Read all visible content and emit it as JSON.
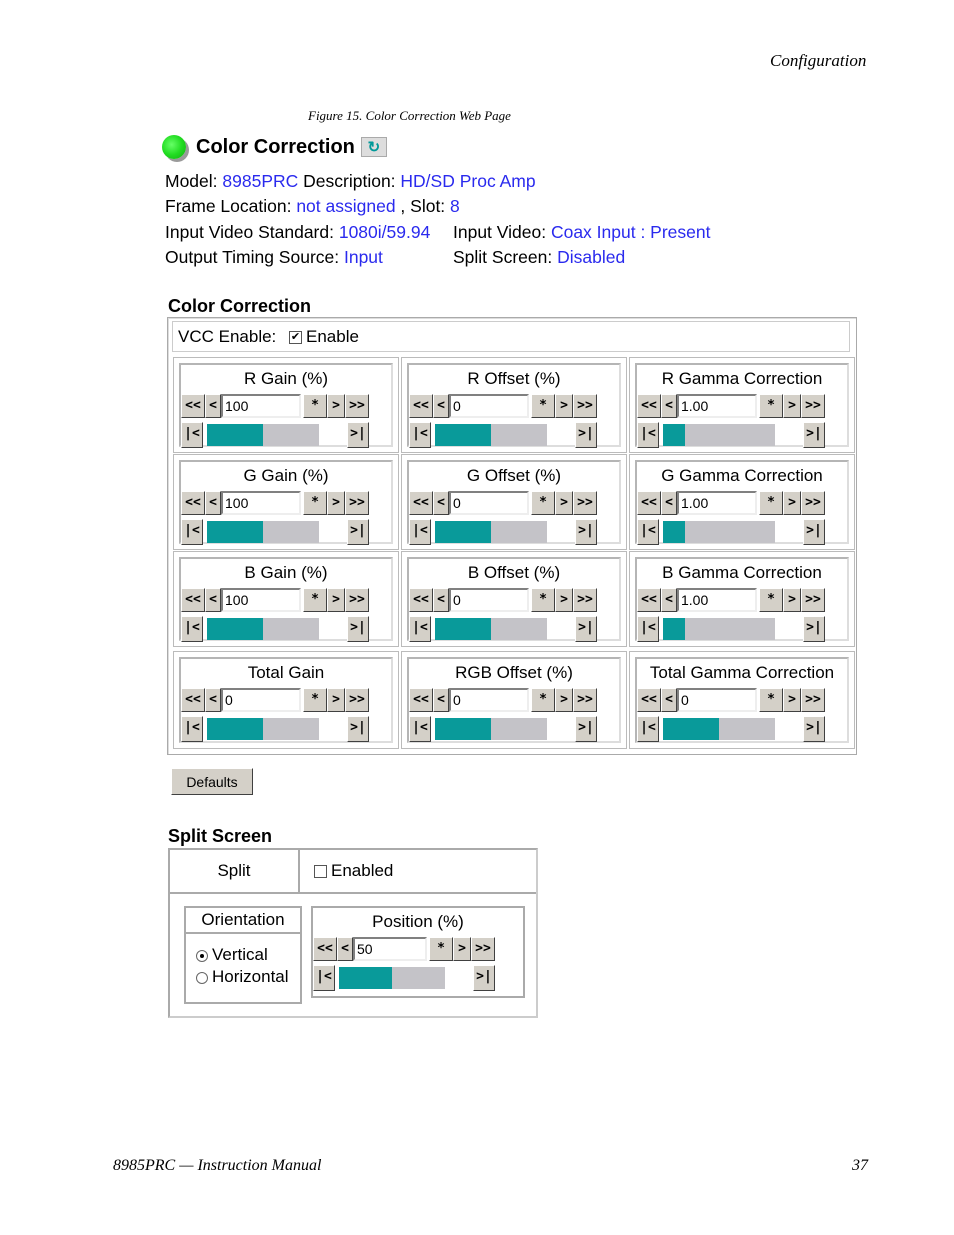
{
  "page": {
    "running_head": "Configuration",
    "figure_caption": "Figure 15.  Color Correction Web Page",
    "footer_left": "8985PRC — Instruction Manual",
    "footer_right": "37"
  },
  "header": {
    "status_led_color": "#22dd22",
    "title": "Color Correction",
    "refresh_icon": "refresh-icon",
    "refresh_glyph": "↻"
  },
  "info": {
    "model_label": "Model: ",
    "model_value": "8985PRC",
    "description_label": " Description: ",
    "description_value": "HD/SD Proc Amp",
    "frame_location_label": "Frame Location: ",
    "frame_location_value": "not assigned",
    "slot_label": " , Slot: ",
    "slot_value": "8",
    "input_std_label": "Input Video Standard: ",
    "input_std_value": "1080i/59.94",
    "input_video_label": "Input Video:  ",
    "input_video_value": "Coax Input : Present",
    "output_timing_label": "Output Timing Source: ",
    "output_timing_value": "Input",
    "split_screen_label": "Split Screen: ",
    "split_screen_value": "Disabled"
  },
  "color_correction": {
    "section_title": "Color Correction",
    "vcc_label": "VCC Enable: ",
    "vcc_checkbox_label": "Enable",
    "vcc_checked": true,
    "buttons": {
      "fast_back": "<<",
      "back": "<",
      "default": "*",
      "fwd": ">",
      "fast_fwd": ">>",
      "min": "|<",
      "max": ">|"
    },
    "controls": [
      {
        "label": "R Gain (%)",
        "value": "100",
        "fill_fraction": 0.5
      },
      {
        "label": "R Offset (%)",
        "value": "0",
        "fill_fraction": 0.5
      },
      {
        "label": "R Gamma Correction",
        "value": "1.00",
        "fill_fraction": 0.2
      },
      {
        "label": "G Gain (%)",
        "value": "100",
        "fill_fraction": 0.5
      },
      {
        "label": "G Offset (%)",
        "value": "0",
        "fill_fraction": 0.5
      },
      {
        "label": "G Gamma Correction",
        "value": "1.00",
        "fill_fraction": 0.2
      },
      {
        "label": "B Gain (%)",
        "value": "100",
        "fill_fraction": 0.5
      },
      {
        "label": "B Offset (%)",
        "value": "0",
        "fill_fraction": 0.5
      },
      {
        "label": "B Gamma Correction",
        "value": "1.00",
        "fill_fraction": 0.2
      },
      {
        "label": "Total Gain",
        "value": "0",
        "fill_fraction": 0.5
      },
      {
        "label": "RGB Offset (%)",
        "value": "0",
        "fill_fraction": 0.5
      },
      {
        "label": "Total Gamma Correction",
        "value": "0",
        "fill_fraction": 0.5
      }
    ],
    "defaults_label": "Defaults"
  },
  "split_screen": {
    "section_title": "Split Screen",
    "split_label": "Split",
    "enabled_label": "Enabled",
    "enabled_checked": false,
    "orientation_title": "Orientation",
    "orientation_options": [
      "Vertical",
      "Horizontal"
    ],
    "orientation_selected": "Vertical",
    "position": {
      "label": "Position (%)",
      "value": "50",
      "fill_fraction": 0.5
    }
  },
  "colors": {
    "link": "#2a2aee",
    "slider_fill": "#099a9a",
    "slider_track": "#c4c3c8",
    "button_face": "#d4d0c8"
  }
}
